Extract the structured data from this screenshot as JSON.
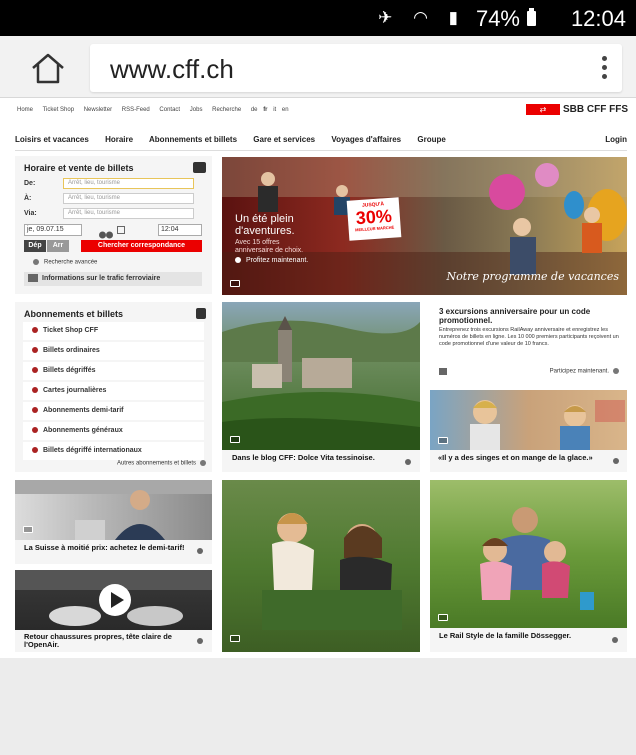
{
  "status_bar": {
    "battery": "74%",
    "time": "12:04"
  },
  "browser": {
    "url": "www.cff.ch"
  },
  "topnav": [
    "Home",
    "Ticket Shop",
    "Newsletter",
    "RSS-Feed",
    "Contact",
    "Jobs",
    "Recherche",
    "de",
    "fr",
    "it",
    "en"
  ],
  "logo": "SBB CFF FFS",
  "mainnav": [
    "Loisirs et vacances",
    "Horaire",
    "Abonnements et billets",
    "Gare et services",
    "Voyages d'affaires",
    "Groupe"
  ],
  "login": "Login",
  "timetable": {
    "title": "Horaire et vente de billets",
    "from_label": "De:",
    "to_label": "À:",
    "via_label": "Via:",
    "placeholder": "Arrêt, lieu, tourisme",
    "date": "je, 09.07.15",
    "time": "12:04",
    "dep": "Dép",
    "arr": "Arr",
    "search": "Chercher correspondance",
    "advanced": "Recherche avancée",
    "traffic": "Informations sur le trafic ferroviaire"
  },
  "hero": {
    "title_line1": "Un été plein",
    "title_line2": "d'aventures.",
    "sub_line1": "Avec 15 offres",
    "sub_line2": "anniversaire de choix.",
    "cta": "Profitez maintenant.",
    "badge_top": "JUSQU'À",
    "badge_pct": "30%",
    "badge_bottom": "MEILLEUR MARCHÉ",
    "script": "Notre programme de vacances"
  },
  "subscriptions": {
    "title": "Abonnements et billets",
    "items": [
      "Ticket Shop CFF",
      "Billets ordinaires",
      "Billets dégriffés",
      "Cartes journalières",
      "Abonnements demi-tarif",
      "Abonnements généraux",
      "Billets dégriffé internationaux"
    ],
    "more": "Autres abonnements et billets"
  },
  "teasers": {
    "blog": "Dans le blog CFF: Dolce Vita tessinoise.",
    "excursions_title": "3 excursions anniversaire pour un code promotionnel.",
    "excursions_text": "Entreprenez trois excursions RailAway anniversaire et enregistrez les numéros de billets en ligne. Les 10 000 premiers participants reçoivent un code promotionnel d'une valeur de 10 francs.",
    "excursions_cta": "Participez maintenant.",
    "singes": "«Il y a des singes et on mange de la glace.»",
    "demitarif": "La Suisse à moitié prix: achetez le demi-tarif!",
    "openair": "Retour chaussures propres, tête claire de l'OpenAir.",
    "railstyle": "Le Rail Style de la famille Dössegger."
  },
  "colors": {
    "brand_red": "#eb0000",
    "text_dark": "#222222"
  }
}
